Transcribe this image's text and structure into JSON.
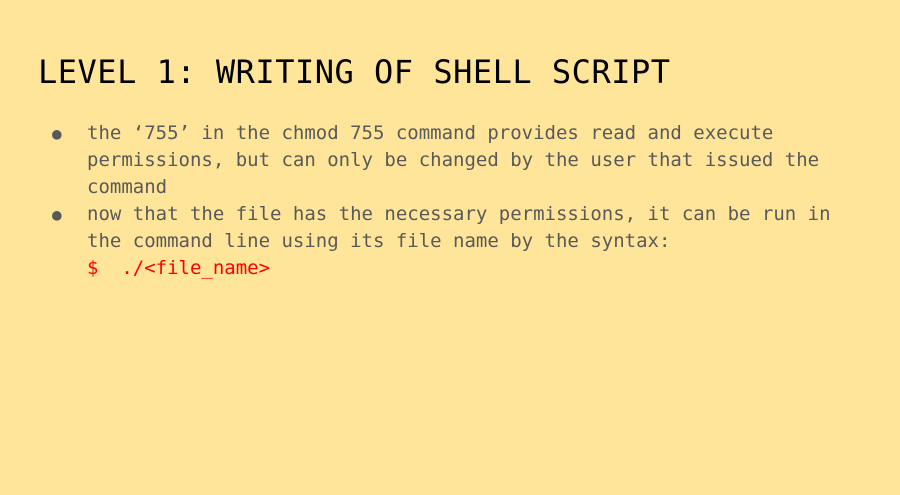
{
  "slide": {
    "title": "LEVEL 1: WRITING OF SHELL SCRIPT",
    "bullets": [
      {
        "text": "the ‘755’ in the chmod 755 command provides read and execute permissions, but can only be changed by the user that issued the command"
      },
      {
        "text": "now that the file has the necessary permissions, it can be run in the command line using its file name by the syntax:",
        "command": "$  ./<file_name>"
      }
    ],
    "bullet_icon": "bullet-dot",
    "colors": {
      "background": "#FFE599",
      "title": "#000000",
      "body_text": "#595959",
      "command": "#FF0000"
    }
  }
}
